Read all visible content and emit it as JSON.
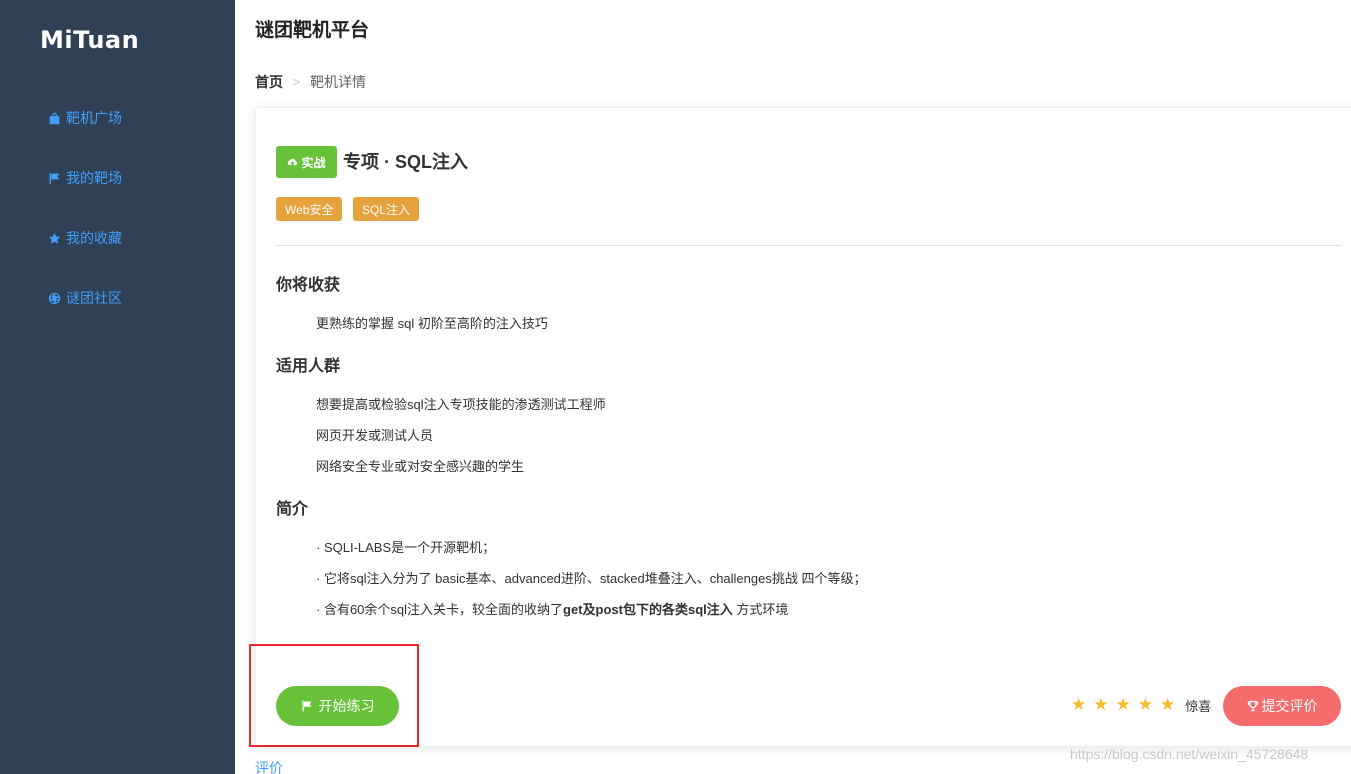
{
  "app": {
    "logo": "MiTuan",
    "title": "谜团靶机平台"
  },
  "sidebar": {
    "items": [
      {
        "label": "靶机广场",
        "icon": "bag-icon"
      },
      {
        "label": "我的靶场",
        "icon": "flag-icon"
      },
      {
        "label": "我的收藏",
        "icon": "star-icon"
      },
      {
        "label": "谜团社区",
        "icon": "community-icon"
      }
    ]
  },
  "breadcrumb": {
    "home": "首页",
    "current": "靶机详情"
  },
  "target": {
    "badge": "实战",
    "title": "专项 · SQL注入",
    "tags": [
      "Web安全",
      "SQL注入"
    ]
  },
  "sections": {
    "gain": {
      "heading": "你将收获",
      "lines": [
        "更熟练的掌握 sql 初阶至高阶的注入技巧"
      ]
    },
    "audience": {
      "heading": "适用人群",
      "lines": [
        "想要提高或检验sql注入专项技能的渗透测试工程师",
        "网页开发或测试人员",
        "网络安全专业或对安全感兴趣的学生"
      ]
    },
    "intro": {
      "heading": "简介",
      "line1": "· SQLI-LABS是一个开源靶机；",
      "line2": "· 它将sql注入分为了 basic基本、advanced进阶、stacked堆叠注入、challenges挑战 四个等级；",
      "line3_pre": "· 含有60余个sql注入关卡，较全面的收纳了",
      "line3_bold": "get及post包下的各类sql注入",
      "line3_post": " 方式环境"
    }
  },
  "actions": {
    "start": "开始练习",
    "submit": "提交评价"
  },
  "rating": {
    "stars": 5,
    "max": 5,
    "text": "惊喜",
    "star_color": "#f7ba2a"
  },
  "footer": {
    "link": "评价",
    "watermark": "https://blog.csdn.net/weixin_45728648"
  },
  "colors": {
    "sidebar_bg": "#304156",
    "accent": "#409eff",
    "success": "#67c23a",
    "warning": "#e6a23c",
    "danger": "#f56c6c",
    "highlight_box": "#e8262c"
  }
}
